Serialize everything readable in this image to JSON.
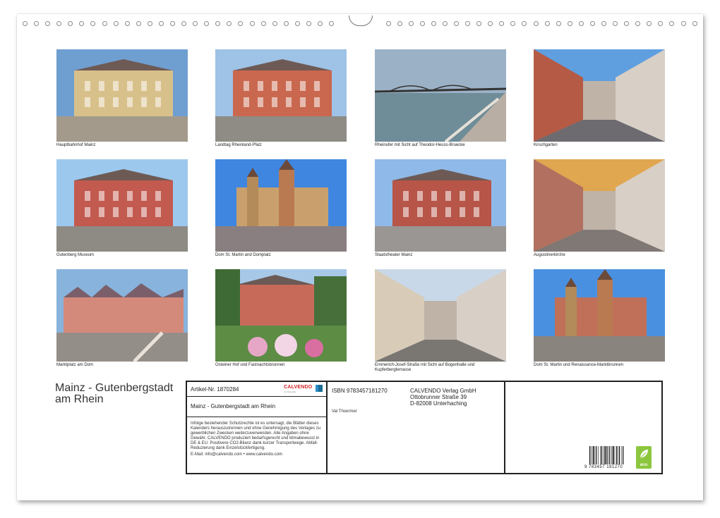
{
  "calendar": {
    "title": "Mainz - Gutenbergstadt am Rhein"
  },
  "photos": [
    {
      "caption": "Hauptbahnhof Mainz",
      "icon": "building-photo"
    },
    {
      "caption": "Landtag Rheinland-Pfalz",
      "icon": "building-photo"
    },
    {
      "caption": "Rheinufer mit Sicht auf Theodor-Heuss-Bruecke",
      "icon": "bridge-photo"
    },
    {
      "caption": "Kirschgarten",
      "icon": "street-photo"
    },
    {
      "caption": "Gutenberg Museum",
      "icon": "building-photo"
    },
    {
      "caption": "Dom St. Martin and Domplatz",
      "icon": "cathedral-photo"
    },
    {
      "caption": "Staatstheater Mainz",
      "icon": "building-photo"
    },
    {
      "caption": "Augustinerkirche",
      "icon": "street-photo"
    },
    {
      "caption": "Marktplatz am Dom",
      "icon": "square-photo"
    },
    {
      "caption": "Osteiner Hof und Fastnachtsbrunnen",
      "icon": "garden-photo"
    },
    {
      "caption": "Emmerich-Josef-Straße mit Sicht auf Bogenhalle und Kupferbergterrasse",
      "icon": "street-photo"
    },
    {
      "caption": "Dom St. Martin und Renaissance-Marktbrunnen",
      "icon": "cathedral-photo"
    }
  ],
  "info": {
    "article": "Artikel-Nr. 1870284",
    "logo": "CALVENDO",
    "logo_sub": "Art-Calendar",
    "product_title": "Mainz - Gutenbergstadt am Rhein",
    "legal": "Infolge bestehender Schutzrechte ist es untersagt, die Blätter dieses Kalenders herauszutrennen und ohne Genehmigung des Verlages zu gewerblichen Zwecken weiterzuverwenden. Alle Angaben ohne Gewähr. CALVENDO produziert bedarfsgerecht und klimabewusst in DE & EU. Positivere CO2-Bilanz dank kurzer Transportwege. Abfall-Reduzierung dank Einzelstückfertigung.",
    "email": "E-Mail: info@calvendo.com • www.calvendo.com",
    "isbn": "ISBN 9783457181270",
    "author": "Val Thoermer",
    "publisher_name": "CALVENDO Verlag GmbH",
    "publisher_street": "Ottobrunner Straße 39",
    "publisher_city": "D-82008 Unterhaching",
    "barcode_number": "9 783457 181270",
    "eco_label": "eco"
  },
  "colors": {
    "sky": "#7fb0da",
    "building_red": "#c0604f",
    "sandstone": "#c9b27d",
    "pavement": "#9a938a",
    "eco_green": "#8cc63f",
    "calvendo_red": "#d2232a"
  }
}
